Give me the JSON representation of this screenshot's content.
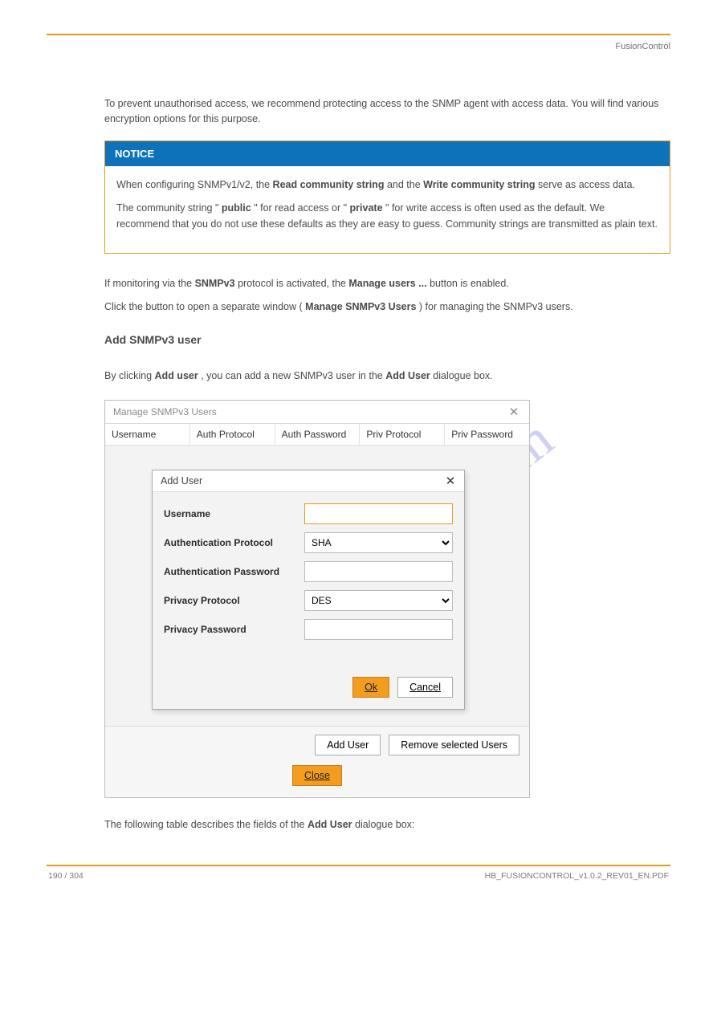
{
  "header": {
    "title": "FusionControl"
  },
  "intro": "To prevent unauthorised access, we recommend protecting access to the SNMP agent with access data. You will find various encryption options for this purpose.",
  "notice": {
    "title": "NOTICE",
    "p1_prefix": "When configuring SNMPv1/v2, the ",
    "p1_strong": "Read community string",
    "p1_mid": " and the ",
    "p1_strong2": "Write community string",
    "p1_suffix": " serve as access data.",
    "p2_prefix": "The community string \"",
    "p2_strong": "public",
    "p2_mid": "\" for read access or \"",
    "p2_strong2": "private",
    "p2_suffix": "\" for write access is often used as the default. We recommend that you do not use these defaults as they are easy to guess. Community strings are transmitted as plain text."
  },
  "section1": {
    "p1_prefix": "If monitoring via the ",
    "p1_strong": "SNMPv3",
    "p1_mid": " protocol is activated, the ",
    "p1_strong2": "Manage users ...",
    "p1_suffix": " button is enabled.",
    "p2_prefix": "Click the button to open a separate window (",
    "p2_strong": "Manage SNMPv3 Users",
    "p2_suffix": ") for managing the SNMPv3 users."
  },
  "mini_heading": "Add SNMPv3 user",
  "addline": {
    "prefix": "By clicking ",
    "strong": "Add user",
    "mid": ", you can add a new SNMPv3 user in the ",
    "strong2": "Add User",
    "suffix": " dialogue box."
  },
  "manage_window": {
    "title": "Manage SNMPv3 Users",
    "columns": [
      "Username",
      "Auth Protocol",
      "Auth Password",
      "Priv Protocol",
      "Priv Password"
    ]
  },
  "add_user_dialog": {
    "title": "Add User",
    "rows": {
      "username": "Username",
      "auth_proto": "Authentication Protocol",
      "auth_pass": "Authentication Password",
      "priv_proto": "Privacy Protocol",
      "priv_pass": "Privacy Password"
    },
    "values": {
      "username": "",
      "auth_proto": "SHA",
      "auth_pass": "",
      "priv_proto": "DES",
      "priv_pass": ""
    },
    "ok": "Ok",
    "cancel": "Cancel"
  },
  "bottom_buttons": {
    "add": "Add User",
    "remove": "Remove selected Users",
    "close": "Close"
  },
  "table_caption": {
    "prefix": "The following table describes the fields of the ",
    "strong": "Add User",
    "suffix": " dialogue box:"
  },
  "footer": {
    "left": "190 / 304",
    "right": "HB_FUSIONCONTROL_v1.0.2_REV01_EN.PDF"
  },
  "watermark": "manualshive.com"
}
